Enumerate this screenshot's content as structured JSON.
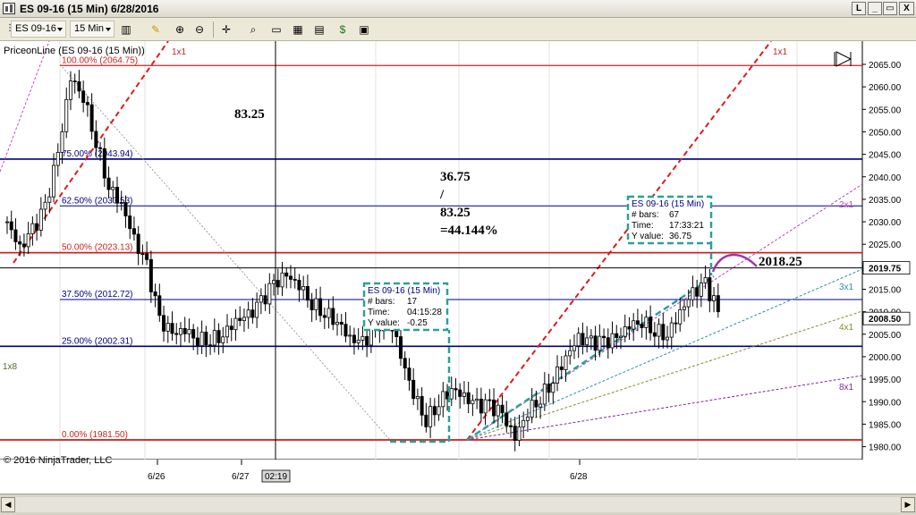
{
  "window": {
    "title": "ES 09-16 (15 Min)  6/28/2016",
    "buttons": [
      "L",
      "_",
      "▭",
      "X"
    ]
  },
  "toolbar": {
    "instrument": "ES 09-16",
    "interval": "15 Min",
    "icons": [
      "pencil-icon",
      "zoom-icon",
      "crosshair-icon",
      "data-box-icon",
      "bar-chart-icon",
      "candle-chart-icon",
      "line-chart-icon",
      "dollar-icon",
      "properties-icon"
    ]
  },
  "chart": {
    "series_label": "PriceonLine (ES 09-16 (15 Min))",
    "copyright": "© 2016 NinjaTrader, LLC",
    "current_price_label": "2008.50",
    "crosshair_price_label": "2019.75",
    "crosshair_time_label": "02:19",
    "left_label": "1x8",
    "annotations": {
      "range": "83.25",
      "ratio_line1": "36.75",
      "ratio_line2": "/",
      "ratio_line3": "83.25",
      "ratio_line4": "=44.144%",
      "target": "2018.25"
    },
    "tooltips": [
      {
        "title": "ES 09-16 (15 Min)",
        "bars_label": "# bars:",
        "bars": "17",
        "time_label": "Time:",
        "time": "04:15:28",
        "y_label": "Y value:",
        "y": "-0.25"
      },
      {
        "title": "ES 09-16 (15 Min)",
        "bars_label": "# bars:",
        "bars": "67",
        "time_label": "Time:",
        "time": "17:33:21",
        "y_label": "Y value:",
        "y": "36.75"
      }
    ],
    "fib_levels": [
      {
        "label": "100.00% (2064.75)",
        "value": 2064.75,
        "color": "#cc2222"
      },
      {
        "label": "75.00% (2043.94)",
        "value": 2043.94,
        "color": "#000080"
      },
      {
        "label": "62.50% (2033.53)",
        "value": 2033.53,
        "color": "#000080"
      },
      {
        "label": "50.00% (2023.13)",
        "value": 2023.13,
        "color": "#cc2222"
      },
      {
        "label": "37.50% (2012.72)",
        "value": 2012.72,
        "color": "#000080"
      },
      {
        "label": "25.00% (2002.31)",
        "value": 2002.31,
        "color": "#000080"
      },
      {
        "label": "0.00% (1981.50)",
        "value": 1981.5,
        "color": "#cc2222"
      }
    ],
    "gann_labels": [
      "1x1",
      "1x1",
      "2x1",
      "3x1",
      "4x1",
      "8x1"
    ]
  },
  "chart_data": {
    "type": "candlestick",
    "instrument": "ES 09-16 (15 Min)",
    "date": "6/28/2016",
    "x_tick_labels": [
      "6/26",
      "6/27",
      "6/28"
    ],
    "y_ticks": [
      1980,
      1985,
      1990,
      1995,
      2000,
      2005,
      2010,
      2015,
      2020,
      2025,
      2030,
      2035,
      2040,
      2045,
      2050,
      2055,
      2060,
      2065
    ],
    "y_tick_labels": [
      "1980.00",
      "1985.00",
      "1990.00",
      "1995.00",
      "2000.00",
      "2005.00",
      "2010.00",
      "2015.00",
      "2020.00",
      "2025.00",
      "2030.00",
      "2035.00",
      "2040.00",
      "2045.00",
      "2050.00",
      "2055.00",
      "2060.00",
      "2065.00"
    ],
    "ylim": [
      1978,
      2070
    ],
    "grid": true,
    "legend": "none",
    "high": 2064.75,
    "low": 1981.5,
    "last": 2008.5,
    "close_series": [
      2030,
      2024,
      2028,
      2033,
      2045,
      2062,
      2058,
      2048,
      2038,
      2034,
      2026,
      2020,
      2008,
      2005,
      2006,
      2004,
      2004,
      2005,
      2008,
      2009,
      2012,
      2016,
      2018,
      2016,
      2012,
      2010,
      2008,
      2004,
      2003,
      2006,
      2010,
      2000,
      1992,
      1986,
      1990,
      1993,
      1991,
      1989,
      1989,
      1987,
      1982,
      1988,
      1991,
      1995,
      2000,
      2004,
      2003,
      2003,
      2004,
      2007,
      2008,
      2006,
      2005,
      2010,
      2014,
      2016,
      2010
    ]
  }
}
